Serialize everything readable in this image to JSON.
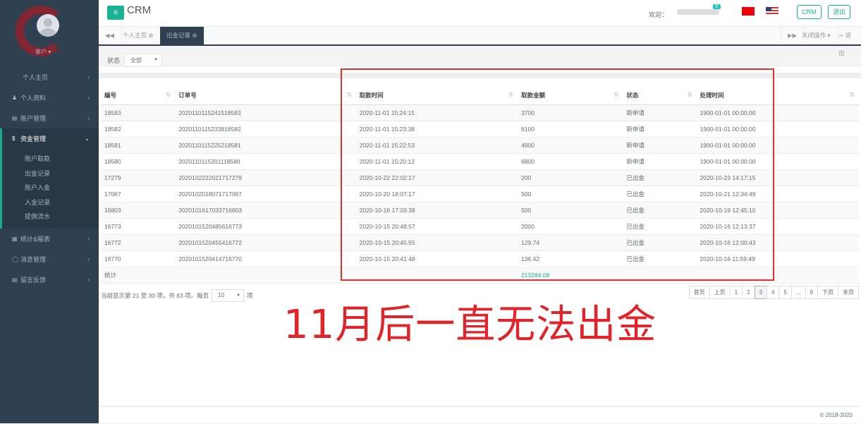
{
  "user": {
    "role": "客户"
  },
  "sidebar": {
    "items": [
      {
        "label": "个人主页",
        "icon": ""
      },
      {
        "label": "个人资料",
        "icon": "user-icon"
      },
      {
        "label": "账户管理",
        "icon": "card-icon"
      },
      {
        "label": "资金管理",
        "icon": "dollar-icon"
      },
      {
        "label": "统计&报表",
        "icon": "chart-icon"
      },
      {
        "label": "消息管理",
        "icon": "comment-icon"
      },
      {
        "label": "留言反馈",
        "icon": "card-icon"
      }
    ],
    "sub": [
      "账户取款",
      "出金记录",
      "账户入金",
      "入金记录",
      "提佣流水"
    ]
  },
  "header": {
    "brand": "CRM",
    "welcome": "欢迎：",
    "badge": "V",
    "crm": "CRM",
    "logout": "退出"
  },
  "tabs": {
    "items": [
      "个人主页",
      "出金记录"
    ],
    "close_ops": "关闭操作",
    "logout": "退出"
  },
  "filter": {
    "label": "状态",
    "value": "全部"
  },
  "table": {
    "headers": [
      "编号",
      "订单号",
      "取款时间",
      "取款金额",
      "状态",
      "处理时间"
    ],
    "rows": [
      [
        "18583",
        "20201101152415185​83",
        "2020-11-01 15:24:15",
        "3700",
        "新申请",
        "1900-01-01 00:00:00"
      ],
      [
        "18582",
        "2020110115233818582",
        "2020-11-01 15:23:38",
        "6100",
        "新申请",
        "1900-01-01 00:00:00"
      ],
      [
        "18581",
        "2020110115225218581",
        "2020-11-01 15:22:53",
        "4900",
        "新申请",
        "1900-01-01 00:00:00"
      ],
      [
        "18580",
        "2020110115201118580",
        "2020-11-01 15:20:12",
        "6800",
        "新申请",
        "1900-01-01 00:00:00"
      ],
      [
        "17279",
        "2020102222021717279",
        "2020-10-22 22:02:17",
        "200",
        "已出金",
        "2020-10-23 14:17:15"
      ],
      [
        "17067",
        "2020102018071717067",
        "2020-10-20 18:07:17",
        "500",
        "已出金",
        "2020-10-21 12:34:49"
      ],
      [
        "16803",
        "2020101617033716803",
        "2020-10-16 17:03:38",
        "500",
        "已出金",
        "2020-10-19 12:45:10"
      ],
      [
        "16773",
        "2020101520485616773",
        "2020-10-15 20:48:57",
        "2000",
        "已出金",
        "2020-10-16 12:13:37"
      ],
      [
        "16772",
        "2020101520455416772",
        "2020-10-15 20:45:55",
        "129.74",
        "已出金",
        "2020-10-16 12:00:43"
      ],
      [
        "16770",
        "2020101520414716770",
        "2020-10-15 20:41:48",
        "136.42",
        "已出金",
        "2020-10-16 11:59:49"
      ]
    ],
    "total_label": "统计",
    "total": "213284.08"
  },
  "pagination": {
    "info": "当前显示第 21 至 30 项，共 83 项。每页",
    "per_page": "10",
    "unit": "项",
    "pages": [
      "首页",
      "上页",
      "1",
      "2",
      "3",
      "4",
      "5",
      "...",
      "9",
      "下页",
      "末页"
    ],
    "current": "3"
  },
  "annotation": "11月后一直无法出金",
  "footer": "© 2018-2020"
}
